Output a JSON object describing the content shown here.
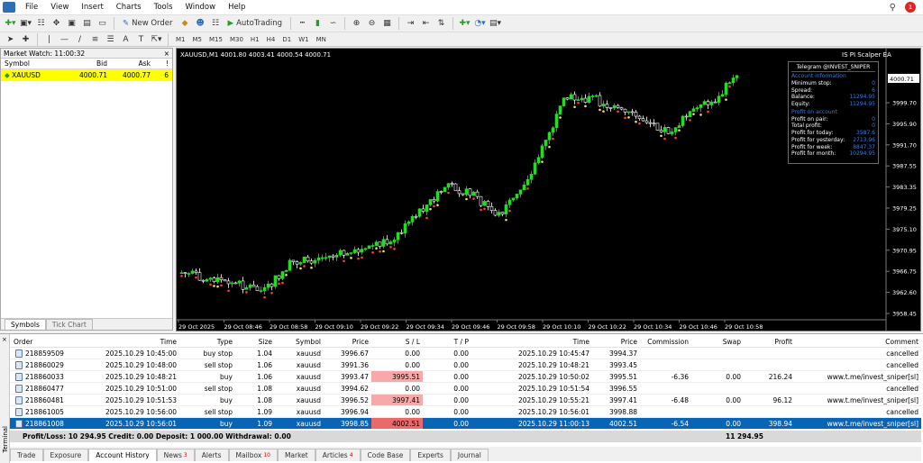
{
  "menu": [
    "File",
    "View",
    "Insert",
    "Charts",
    "Tools",
    "Window",
    "Help"
  ],
  "toolbar": {
    "new_order": "New Order",
    "autotrading": "AutoTrading"
  },
  "timeframes": [
    "M1",
    "M5",
    "M15",
    "M30",
    "H1",
    "H4",
    "D1",
    "W1",
    "MN"
  ],
  "market_watch": {
    "title": "Market Watch: 11:00:32",
    "close": "×",
    "headers": {
      "symbol": "Symbol",
      "bid": "Bid",
      "ask": "Ask",
      "spread": "!"
    },
    "rows": [
      {
        "symbol": "XAUUSD",
        "bid": "4000.71",
        "ask": "4000.77",
        "spread": "6"
      }
    ],
    "tabs": [
      "Symbols",
      "Tick Chart"
    ]
  },
  "chart": {
    "header": "XAUUSD,M1  4001.80 4003.41 4000.54 4000.71",
    "ea_label": "IS PI Scalper EA",
    "current_price": "4000.71",
    "price_labels": [
      "3999.70",
      "3995.90",
      "3991.70",
      "3987.55",
      "3983.35",
      "3979.25",
      "3975.10",
      "3970.95",
      "3966.75",
      "3962.60",
      "3958.45"
    ],
    "time_labels": [
      "29 Oct 2025",
      "29 Oct 08:46",
      "29 Oct 08:58",
      "29 Oct 09:10",
      "29 Oct 09:22",
      "29 Oct 09:34",
      "29 Oct 09:46",
      "29 Oct 09:58",
      "29 Oct 10:10",
      "29 Oct 10:22",
      "29 Oct 10:34",
      "29 Oct 10:46",
      "29 Oct 10:58"
    ],
    "colors": {
      "bull": "#22dd22",
      "bear": "#ffffff",
      "marker_buy": "#ff4040",
      "marker_sell": "#f0e060"
    }
  },
  "infobox": {
    "title": "Telegram @INVEST_SNIPER",
    "section1": "Account information",
    "rows1": [
      [
        "Minimum stop:",
        "0"
      ],
      [
        "Spread:",
        "6"
      ],
      [
        "Balance:",
        "11294.95"
      ],
      [
        "Equity:",
        "11294.95"
      ]
    ],
    "section2": "Profit on account",
    "rows2": [
      [
        "Profit on pair:",
        "0"
      ],
      [
        "Total profit:",
        "0"
      ],
      [
        "Profit for today:",
        "3587.6"
      ],
      [
        "Profit for yesterday:",
        "2713.96"
      ],
      [
        "Profit for week:",
        "8847.37"
      ],
      [
        "Profit for month:",
        "10294.95"
      ]
    ]
  },
  "orders": {
    "headers": [
      "Order",
      "Time",
      "Type",
      "Size",
      "Symbol",
      "Price",
      "S / L",
      "T / P",
      "Time",
      "Price",
      "Commission",
      "Swap",
      "Profit",
      "Comment"
    ],
    "rows": [
      [
        "218859509",
        "2025.10.29 10:45:00",
        "buy stop",
        "1.04",
        "xauusd",
        "3996.67",
        "0.00",
        "0.00",
        "2025.10.29 10:45:47",
        "3994.37",
        "",
        "",
        "",
        "cancelled"
      ],
      [
        "218860029",
        "2025.10.29 10:48:00",
        "sell stop",
        "1.06",
        "xauusd",
        "3991.36",
        "0.00",
        "0.00",
        "2025.10.29 10:48:21",
        "3993.45",
        "",
        "",
        "",
        "cancelled"
      ],
      [
        "218860033",
        "2025.10.29 10:48:21",
        "buy",
        "1.06",
        "xauusd",
        "3993.47",
        "3995.51",
        "0.00",
        "2025.10.29 10:50:02",
        "3995.51",
        "-6.36",
        "0.00",
        "216.24",
        "www.t.me/invest_sniper[sl]"
      ],
      [
        "218860477",
        "2025.10.29 10:51:00",
        "sell stop",
        "1.08",
        "xauusd",
        "3994.62",
        "0.00",
        "0.00",
        "2025.10.29 10:51:54",
        "3996.55",
        "",
        "",
        "",
        "cancelled"
      ],
      [
        "218860481",
        "2025.10.29 10:51:53",
        "buy",
        "1.08",
        "xauusd",
        "3996.52",
        "3997.41",
        "0.00",
        "2025.10.29 10:55:21",
        "3997.41",
        "-6.48",
        "0.00",
        "96.12",
        "www.t.me/invest_sniper[sl]"
      ],
      [
        "218861005",
        "2025.10.29 10:56:00",
        "sell stop",
        "1.09",
        "xauusd",
        "3996.94",
        "0.00",
        "0.00",
        "2025.10.29 10:56:01",
        "3998.88",
        "",
        "",
        "",
        "cancelled"
      ],
      [
        "218861008",
        "2025.10.29 10:56:01",
        "buy",
        "1.09",
        "xauusd",
        "3998.85",
        "4002.51",
        "0.00",
        "2025.10.29 11:00:13",
        "4002.51",
        "-6.54",
        "0.00",
        "398.94",
        "www.t.me/invest_sniper[sl]"
      ]
    ],
    "negative_sl_rows": [
      2,
      4,
      6
    ],
    "selected_row": 6
  },
  "summary": {
    "text": "Profit/Loss: 10 294.95  Credit: 0.00  Deposit: 1 000.00  Withdrawal: 0.00",
    "total": "11 294.95"
  },
  "terminal": {
    "side_label": "Terminal",
    "tabs": [
      {
        "label": "Trade",
        "badge": ""
      },
      {
        "label": "Exposure",
        "badge": ""
      },
      {
        "label": "Account History",
        "badge": ""
      },
      {
        "label": "News",
        "badge": "3"
      },
      {
        "label": "Alerts",
        "badge": ""
      },
      {
        "label": "Mailbox",
        "badge": "10"
      },
      {
        "label": "Market",
        "badge": ""
      },
      {
        "label": "Articles",
        "badge": "4"
      },
      {
        "label": "Code Base",
        "badge": ""
      },
      {
        "label": "Experts",
        "badge": ""
      },
      {
        "label": "Journal",
        "badge": ""
      }
    ],
    "active_tab": 2
  }
}
